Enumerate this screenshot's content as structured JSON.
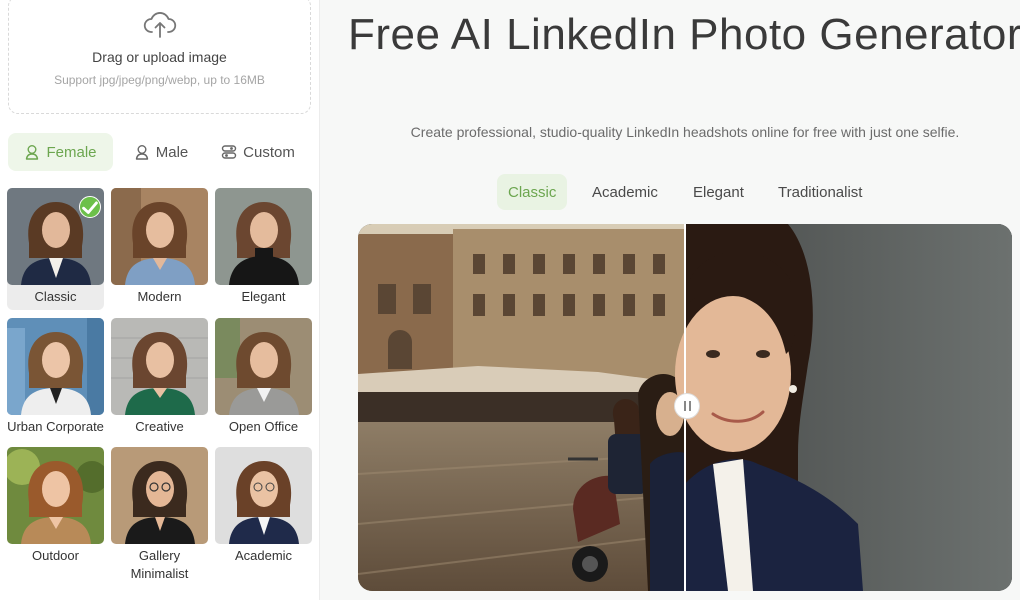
{
  "upload": {
    "title": "Drag or upload image",
    "hint": "Support jpg/jpeg/png/webp, up to 16MB",
    "icon": "cloud-upload-icon"
  },
  "gender_tabs": [
    {
      "label": "Female",
      "icon": "female-icon",
      "active": true
    },
    {
      "label": "Male",
      "icon": "male-icon",
      "active": false
    },
    {
      "label": "Custom",
      "icon": "custom-icon",
      "active": false
    }
  ],
  "styles": [
    {
      "label": "Classic",
      "selected": true
    },
    {
      "label": "Modern",
      "selected": false
    },
    {
      "label": "Elegant",
      "selected": false
    },
    {
      "label": "Urban Corporate",
      "selected": false
    },
    {
      "label": "Creative",
      "selected": false
    },
    {
      "label": "Open Office",
      "selected": false
    },
    {
      "label": "Outdoor",
      "selected": false
    },
    {
      "label": "Gallery Minimalist",
      "selected": false
    },
    {
      "label": "Academic",
      "selected": false
    }
  ],
  "hero": {
    "title": "Free AI LinkedIn Photo Generator",
    "subtitle": "Create professional, studio-quality LinkedIn headshots online for free with just one selfie."
  },
  "style_tabs": [
    {
      "label": "Classic",
      "active": true
    },
    {
      "label": "Academic",
      "active": false
    },
    {
      "label": "Elegant",
      "active": false
    },
    {
      "label": "Traditionalist",
      "active": false
    }
  ],
  "colors": {
    "accent": "#6ca64f",
    "accent_bg": "#eef6e9",
    "check": "#6cc04a",
    "panel_bg": "#f7f8f7"
  }
}
